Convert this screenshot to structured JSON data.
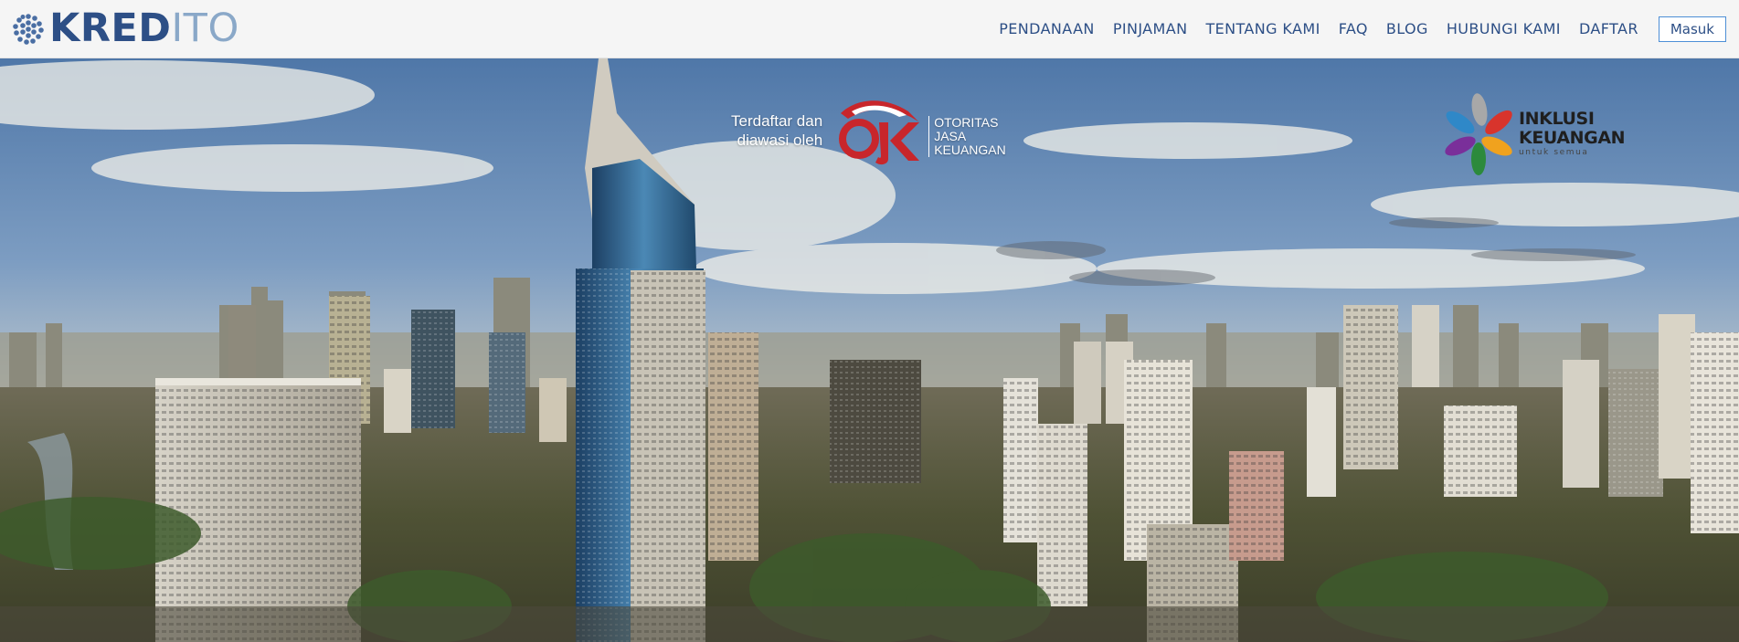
{
  "brand": {
    "name_part1": "KRED",
    "name_part2": "ITO",
    "colors": {
      "primary": "#2d4f86",
      "secondary": "#8aa8c8"
    }
  },
  "nav": {
    "items": [
      {
        "label": "PENDANAAN"
      },
      {
        "label": "PINJAMAN"
      },
      {
        "label": "TENTANG KAMI"
      },
      {
        "label": "FAQ"
      },
      {
        "label": "BLOG"
      },
      {
        "label": "HUBUNGI KAMI"
      },
      {
        "label": "DAFTAR"
      }
    ],
    "login_label": "Masuk"
  },
  "hero": {
    "registration_line1": "Terdaftar dan",
    "registration_line2": "diawasi oleh",
    "ojk": {
      "abbr": "OJK",
      "line1": "OTORITAS",
      "line2": "JASA",
      "line3": "KEUANGAN",
      "color": "#c8262b"
    },
    "inklusi": {
      "line1": "INKLUSI",
      "line2": "KEUANGAN",
      "tagline": "untuk semua"
    }
  },
  "icons": {
    "brand_mark": "dotted-circle-logo-icon",
    "ojk_logo": "ojk-logo-icon",
    "inklusi_logo": "flower-petal-logo-icon"
  }
}
